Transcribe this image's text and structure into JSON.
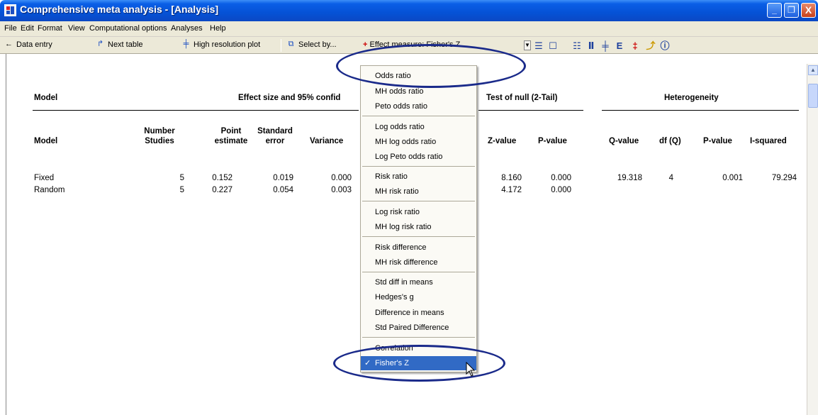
{
  "window": {
    "title": "Comprehensive meta analysis - [Analysis]",
    "minimize_glyph": "_",
    "maximize_glyph": "❐",
    "close_glyph": "X"
  },
  "menubar": {
    "items": [
      {
        "label": "File"
      },
      {
        "label": "Edit"
      },
      {
        "label": "Format"
      },
      {
        "label": "View"
      },
      {
        "label": "Computational options"
      },
      {
        "label": "Analyses"
      },
      {
        "label": "Help"
      }
    ]
  },
  "toolbar": {
    "data_entry": "Data entry",
    "next_table": "Next table",
    "high_res_plot": "High resolution plot",
    "select_by": "Select by...",
    "effect_measure": "Effect measure: Fisher's Z"
  },
  "table": {
    "group_headers": {
      "model": "Model",
      "effect_size": "Effect size and 95% confid",
      "test_null": "Test of null (2-Tail)",
      "heterogeneity": "Heterogeneity"
    },
    "columns": {
      "model": "Model",
      "number_studies_1": "Number",
      "number_studies_2": "Studies",
      "point_estimate_1": "Point",
      "point_estimate_2": "estimate",
      "standard_error_1": "Standard",
      "standard_error_2": "error",
      "variance": "Variance",
      "z_value": "Z-value",
      "p_value": "P-value",
      "q_value": "Q-value",
      "df_q": "df (Q)",
      "het_p_value": "P-value",
      "i_squared": "I-squared"
    },
    "rows": [
      {
        "model": "Fixed",
        "studies": "5",
        "point": "0.152",
        "se": "0.019",
        "variance": "0.000",
        "z": "8.160",
        "p": "0.000",
        "q": "19.318",
        "df": "4",
        "hp": "0.001",
        "i2": "79.294"
      },
      {
        "model": "Random",
        "studies": "5",
        "point": "0.227",
        "se": "0.054",
        "variance": "0.003",
        "z": "4.172",
        "p": "0.000",
        "q": "",
        "df": "",
        "hp": "",
        "i2": ""
      }
    ]
  },
  "effect_menu": {
    "items": [
      "Odds ratio",
      "MH odds ratio",
      "Peto odds ratio",
      "Log odds ratio",
      "MH log odds ratio",
      "Log Peto odds ratio",
      "Risk ratio",
      "MH risk ratio",
      "Log risk ratio",
      "MH log risk ratio",
      "Risk difference",
      "MH risk difference",
      "Std diff in means",
      "Hedges's g",
      "Difference in means",
      "Std Paired Difference",
      "Correlation",
      "Fisher's Z"
    ],
    "selected": "Fisher's Z",
    "check_glyph": "✓"
  },
  "colors": {
    "titlebar": "#0552d6",
    "menu_bg": "#ece9d8",
    "selection": "#316ac5",
    "annotation": "#1a2a8a"
  }
}
